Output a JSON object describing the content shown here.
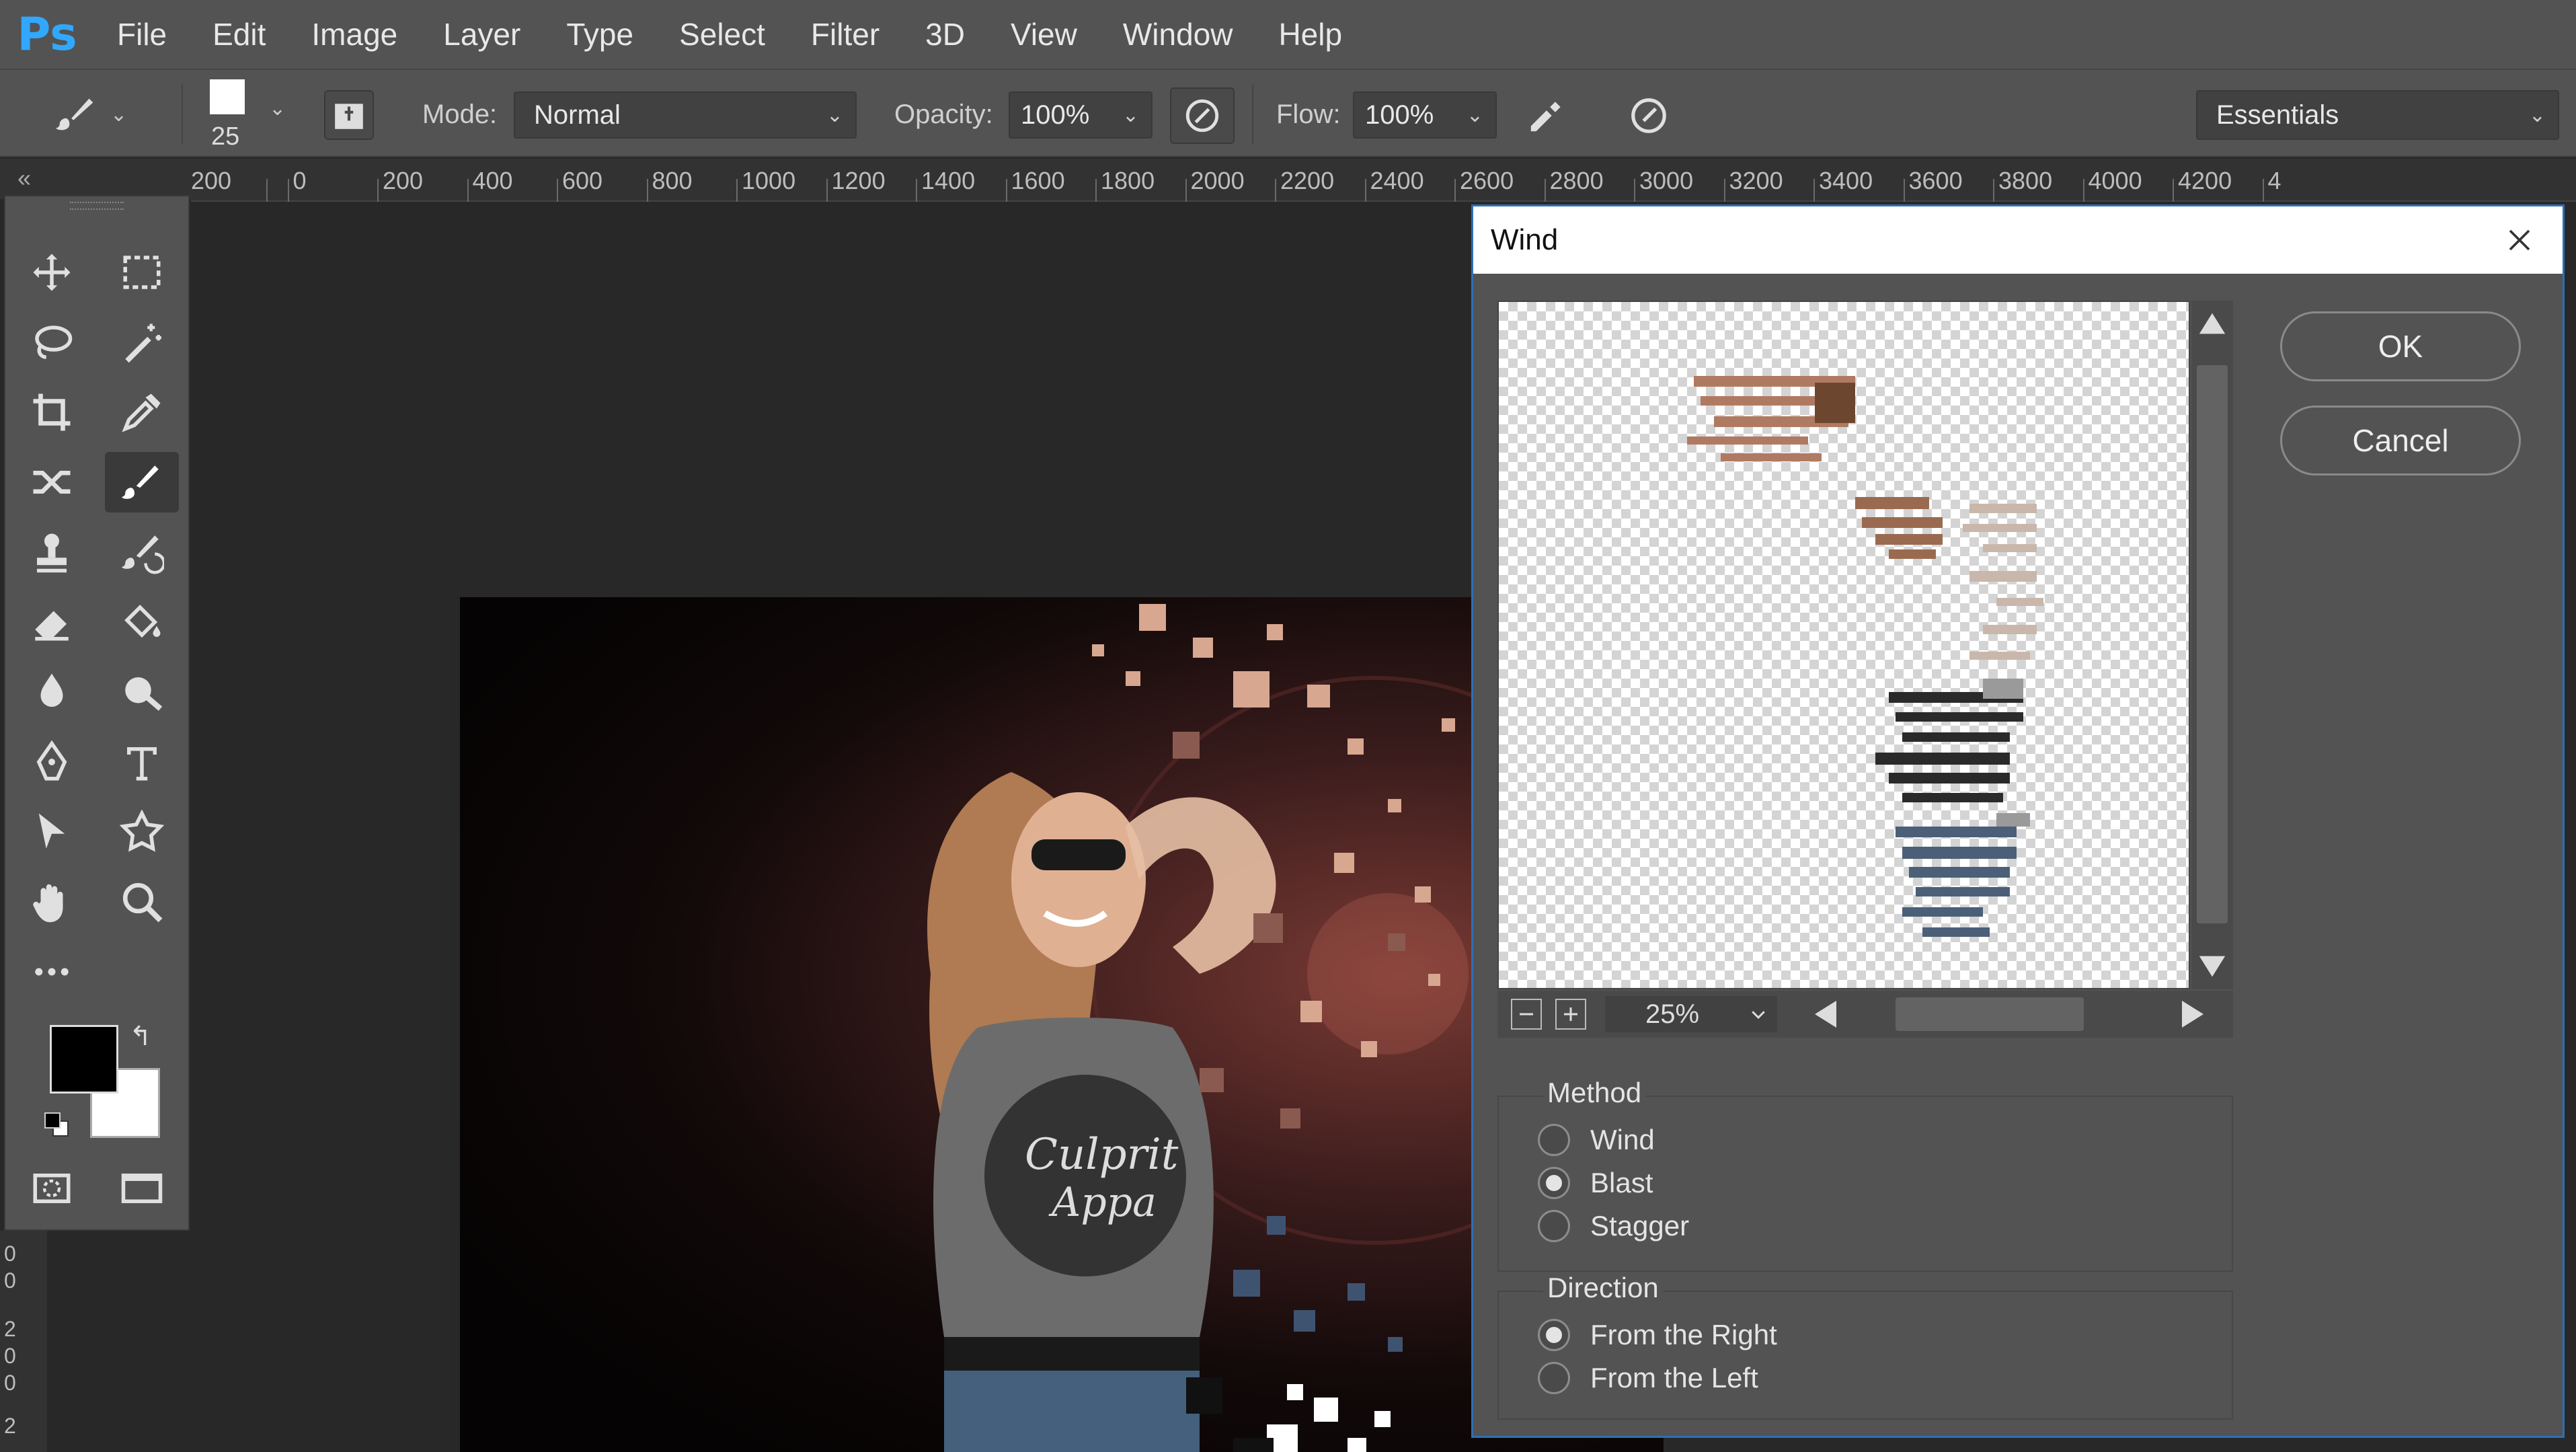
{
  "app": {
    "logo": "Ps"
  },
  "menu": [
    "File",
    "Edit",
    "Image",
    "Layer",
    "Type",
    "Select",
    "Filter",
    "3D",
    "View",
    "Window",
    "Help"
  ],
  "options_bar": {
    "brush_size": "25",
    "mode_label": "Mode:",
    "mode_value": "Normal",
    "opacity_label": "Opacity:",
    "opacity_value": "100%",
    "flow_label": "Flow:",
    "flow_value": "100%",
    "workspace": "Essentials"
  },
  "ruler": {
    "marks": [
      "200",
      "0",
      "200",
      "400",
      "600",
      "800",
      "1000",
      "1200",
      "1400",
      "1600",
      "1800",
      "2000",
      "2200",
      "2400",
      "2600",
      "2800",
      "3000",
      "3200",
      "3400",
      "3600",
      "3800",
      "4000",
      "4200",
      "4"
    ],
    "left_marks": [
      "0",
      "0",
      "2",
      "0",
      "0",
      "2"
    ]
  },
  "colors": {
    "accent": "#31a8ff",
    "foreground": "#000000",
    "background": "#ffffff",
    "dialog_border": "#2e6fb5"
  },
  "tools": [
    "move-icon",
    "marquee-icon",
    "lasso-icon",
    "magic-wand-icon",
    "crop-icon",
    "eyedropper-icon",
    "healing-icon",
    "brush-icon",
    "stamp-icon",
    "history-brush-icon",
    "eraser-icon",
    "paint-bucket-icon",
    "blur-icon",
    "dodge-icon",
    "pen-icon",
    "type-icon",
    "path-select-icon",
    "shape-icon",
    "hand-icon",
    "zoom-icon",
    "more-icon"
  ],
  "dialog": {
    "title": "Wind",
    "ok_label": "OK",
    "cancel_label": "Cancel",
    "zoom": "25%",
    "method": {
      "title": "Method",
      "options": [
        "Wind",
        "Blast",
        "Stagger"
      ],
      "selected": "Blast"
    },
    "direction": {
      "title": "Direction",
      "options": [
        "From the Right",
        "From the Left"
      ],
      "selected": "From the Right"
    }
  },
  "document": {
    "shirt_text_1": "Culprit",
    "shirt_text_2": "Appa"
  }
}
